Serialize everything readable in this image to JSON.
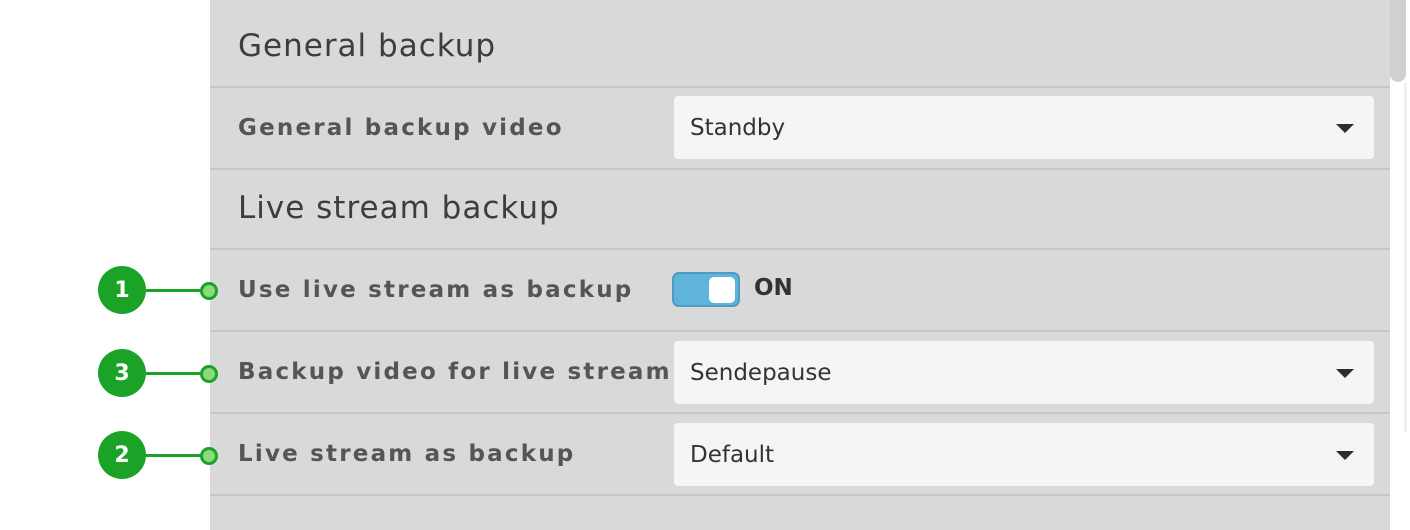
{
  "general_backup": {
    "heading": "General backup",
    "video_label": "General backup video",
    "video_value": "Standby"
  },
  "live_stream_backup": {
    "heading": "Live stream backup",
    "use_live_label": "Use live stream as backup",
    "use_live_state": "ON",
    "backup_video_label": "Backup video for live stream",
    "backup_video_value": "Sendepause",
    "live_as_backup_label": "Live stream as backup",
    "live_as_backup_value": "Default"
  },
  "callouts": [
    "1",
    "3",
    "2"
  ],
  "colors": {
    "callout_green": "#1aa327",
    "toggle_blue": "#5fb4dc",
    "panel_bg": "#d9d9d9"
  },
  "icons": {
    "dropdown": "caret-down-icon"
  }
}
